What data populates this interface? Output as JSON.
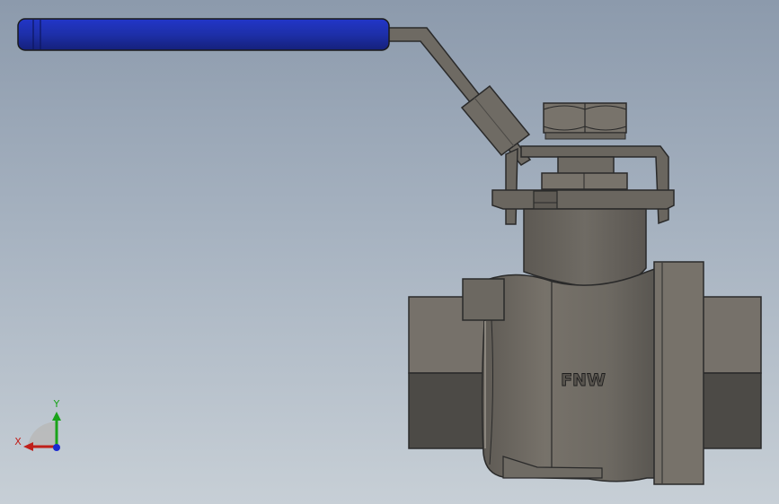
{
  "viewport": {
    "background_top": "#8c9aac",
    "background_bottom": "#c7cfd6"
  },
  "model": {
    "body_marking": "FNW",
    "colors": {
      "handle_grip": "#1d2fa8",
      "metal_light": "#79746c",
      "metal_mid": "#6a665f",
      "metal_dark": "#4c4a46",
      "edge": "#2a2a2a"
    }
  },
  "triad": {
    "x_label": "X",
    "y_label": "Y",
    "x_color": "#c0201a",
    "y_color": "#1aa31a",
    "z_color": "#1a2ad0"
  }
}
